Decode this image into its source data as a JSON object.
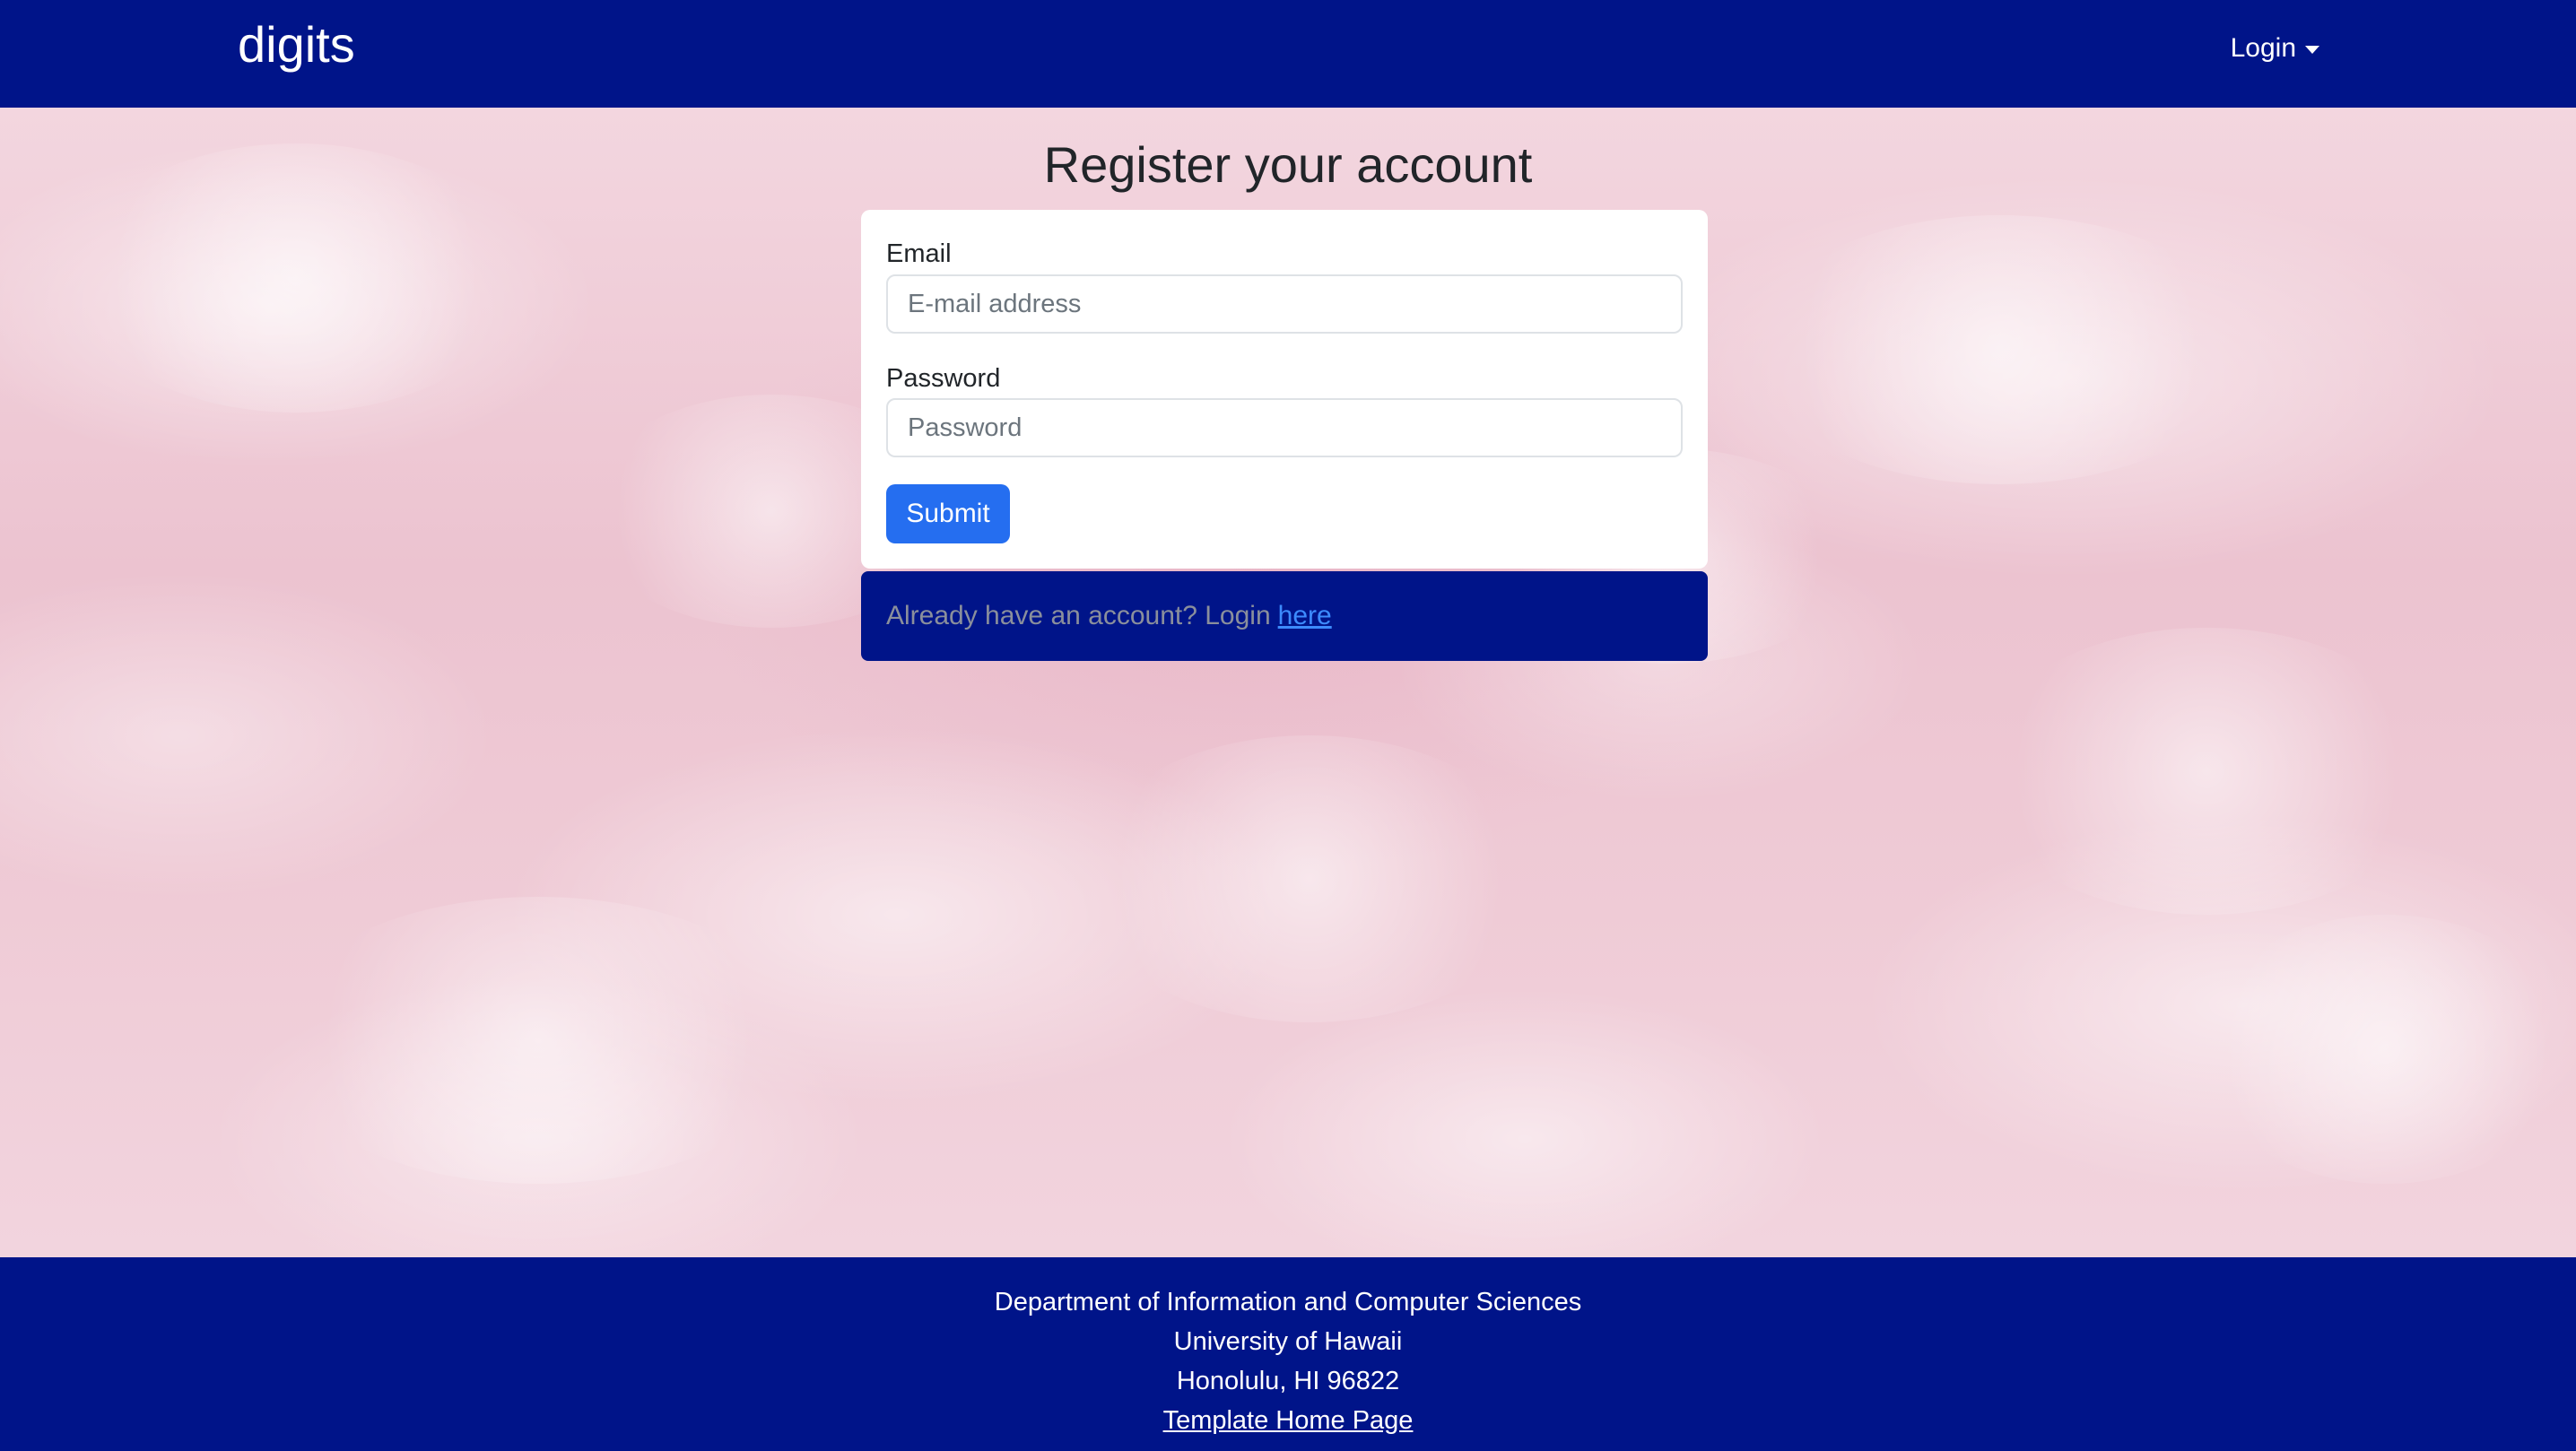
{
  "navbar": {
    "brand": "digits",
    "login_label": "Login"
  },
  "main": {
    "title": "Register your account",
    "form": {
      "email_label": "Email",
      "email_placeholder": "E-mail address",
      "email_value": "",
      "password_label": "Password",
      "password_placeholder": "Password",
      "password_value": "",
      "submit_label": "Submit"
    },
    "alert": {
      "text": "Already have an account? Login",
      "link_label": "here"
    }
  },
  "footer": {
    "line1": "Department of Information and Computer Sciences",
    "line2": "University of Hawaii",
    "line3": "Honolulu, HI 96822",
    "link_label": "Template Home Page"
  },
  "colors": {
    "navbar_bg": "#001489",
    "primary_button": "#256ef0",
    "link": "#3d8bfd",
    "background": "#f1d2dc"
  },
  "icons": {
    "login_caret": "caret-down-icon"
  }
}
